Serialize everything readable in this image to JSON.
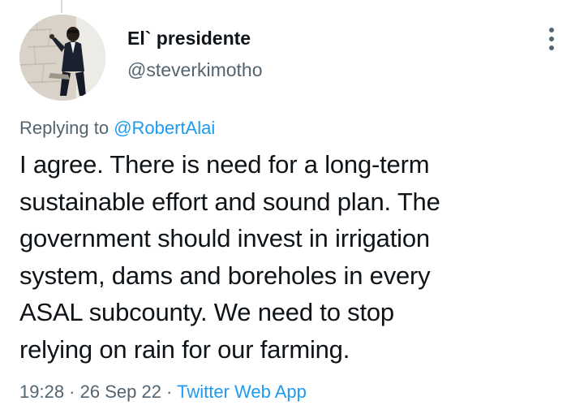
{
  "tweet": {
    "display_name": "El` presidente",
    "handle": "@steverkimotho",
    "replying_prefix": "Replying to ",
    "replying_to": "@RobertAlai",
    "text_lines": [
      "I agree. There is need for a long-term",
      "sustainable effort and sound plan. The",
      "government should invest in irrigation",
      "system, dams and boreholes in every",
      "ASAL subcounty. We need to stop",
      "relying on rain for our farming."
    ],
    "time": "19:28",
    "separator": " · ",
    "date": "26 Sep 22",
    "source": "Twitter Web App"
  },
  "icons": {
    "more": "more-vertical-icon",
    "avatar": "profile-photo"
  },
  "colors": {
    "text": "#0f1419",
    "secondary": "#536471",
    "link": "#1d9bf0",
    "thread_line": "#cfd9de"
  }
}
